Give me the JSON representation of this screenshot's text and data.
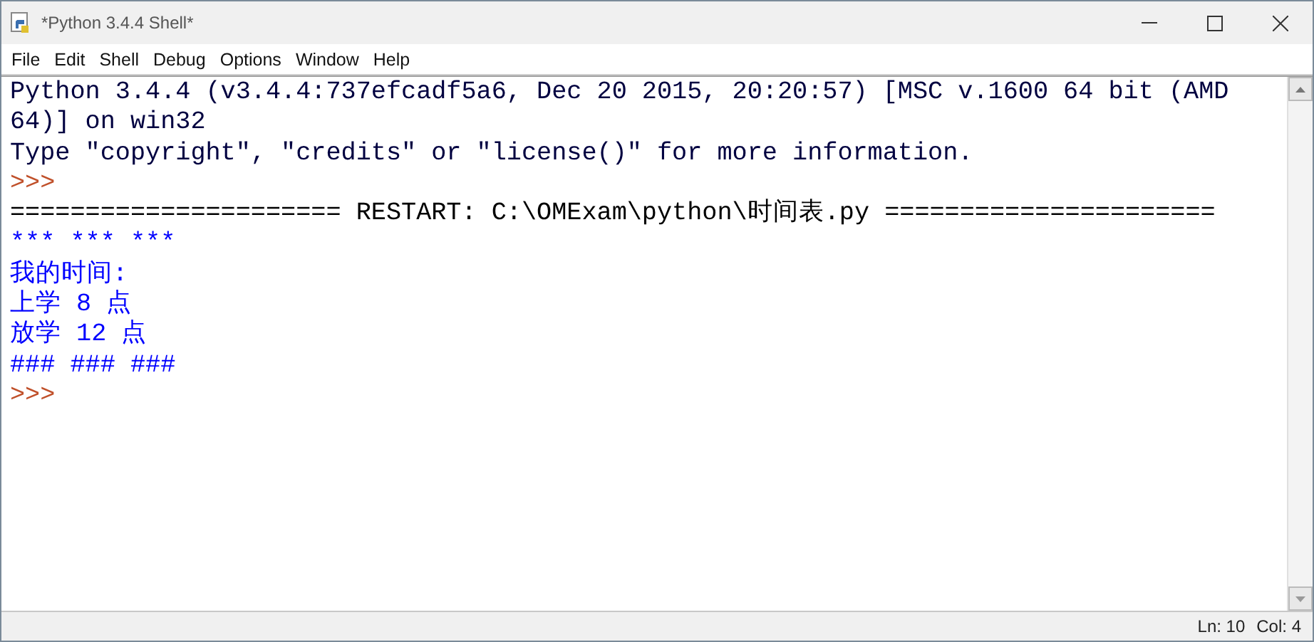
{
  "window": {
    "title": "*Python 3.4.4 Shell*"
  },
  "menu": [
    "File",
    "Edit",
    "Shell",
    "Debug",
    "Options",
    "Window",
    "Help"
  ],
  "shell_lines": [
    {
      "kind": "info",
      "text": "Python 3.4.4 (v3.4.4:737efcadf5a6, Dec 20 2015, 20:20:57) [MSC v.1600 64 bit (AMD"
    },
    {
      "kind": "info",
      "text": "64)] on win32"
    },
    {
      "kind": "info",
      "text": "Type \"copyright\", \"credits\" or \"license()\" for more information."
    },
    {
      "kind": "prompt",
      "text": ">>>"
    },
    {
      "kind": "restart",
      "text": "====================== RESTART: C:\\OMExam\\python\\时间表.py ======================"
    },
    {
      "kind": "stdout",
      "text": "*** *** ***"
    },
    {
      "kind": "stdout",
      "text": "我的时间:"
    },
    {
      "kind": "stdout",
      "text": "上学 8 点"
    },
    {
      "kind": "stdout",
      "text": "放学 12 点"
    },
    {
      "kind": "stdout",
      "text": "### ### ###"
    },
    {
      "kind": "prompt",
      "text": ">>>"
    }
  ],
  "status_bar": {
    "line": "Ln: 10",
    "column": "Col: 4"
  }
}
